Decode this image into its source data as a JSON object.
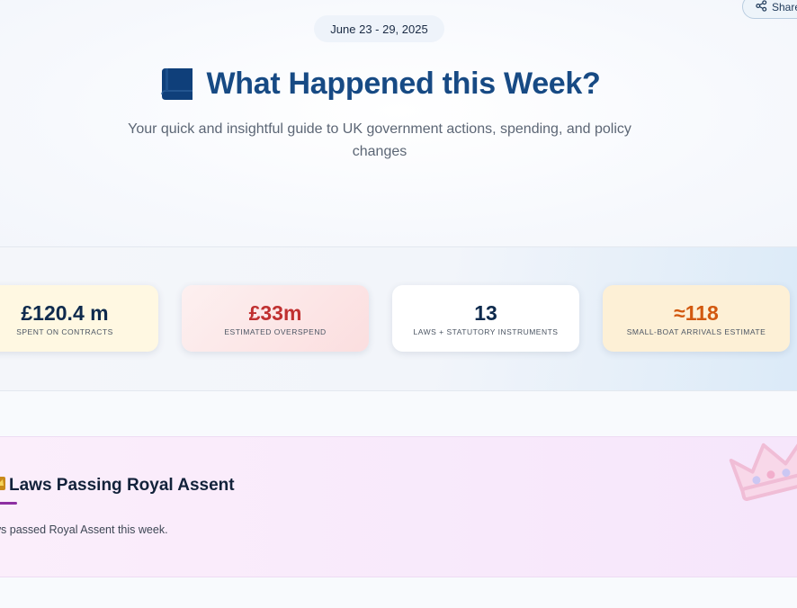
{
  "header": {
    "share_label": "Share",
    "date_range": "June 23 - 29, 2025",
    "title": "What Happened this Week?",
    "subtitle": "Your quick and insightful guide to UK government actions, spending, and policy changes"
  },
  "stats": [
    {
      "value": "£120.4 m",
      "label": "SPENT ON CONTRACTS"
    },
    {
      "value": "£33m",
      "label": "ESTIMATED OVERSPEND"
    },
    {
      "value": "13",
      "label": "LAWS + STATUTORY INSTRUMENTS"
    },
    {
      "value": "≈118",
      "label": "SMALL-BOAT ARRIVALS ESTIMATE"
    }
  ],
  "royal_assent": {
    "heading": "Laws Passing Royal Assent",
    "text": "ws passed Royal Assent this week."
  },
  "colors": {
    "brand_blue": "#174a84",
    "overspend_red": "#c03030",
    "arrivals_orange": "#d2580f",
    "royal_purple": "#8d2fa2"
  },
  "icons": [
    "share-icon",
    "book-icon",
    "crown-icon"
  ]
}
